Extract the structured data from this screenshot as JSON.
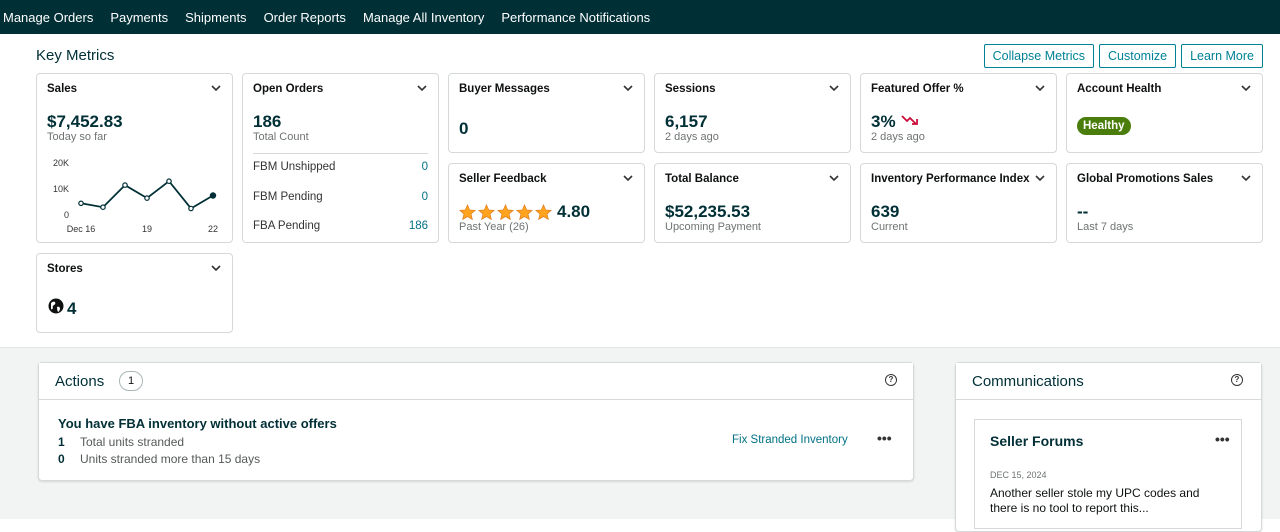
{
  "nav": {
    "items": [
      "Manage Orders",
      "Payments",
      "Shipments",
      "Order Reports",
      "Manage All Inventory",
      "Performance Notifications"
    ]
  },
  "key_metrics": {
    "title": "Key Metrics",
    "buttons": {
      "collapse": "Collapse Metrics",
      "customize": "Customize",
      "learn_more": "Learn More"
    }
  },
  "cards": {
    "sales": {
      "title": "Sales",
      "value": "$7,452.83",
      "sub": "Today so far"
    },
    "open_orders": {
      "title": "Open Orders",
      "value": "186",
      "sub": "Total Count",
      "rows": [
        {
          "label": "FBM Unshipped",
          "value": "0"
        },
        {
          "label": "FBM Pending",
          "value": "0"
        },
        {
          "label": "FBA Pending",
          "value": "186"
        }
      ]
    },
    "buyer_messages": {
      "title": "Buyer Messages",
      "value": "0"
    },
    "sessions": {
      "title": "Sessions",
      "value": "6,157",
      "sub": "2 days ago"
    },
    "featured_offer": {
      "title": "Featured Offer %",
      "value": "3%",
      "sub": "2 days ago",
      "trend_icon": "trend-down-icon"
    },
    "account_health": {
      "title": "Account Health",
      "badge": "Healthy",
      "badge_color": "#4a7d0b"
    },
    "seller_feedback": {
      "title": "Seller Feedback",
      "rating": "4.80",
      "stars": 5,
      "sub": "Past Year (26)"
    },
    "total_balance": {
      "title": "Total Balance",
      "value": "$52,235.53",
      "sub": "Upcoming Payment"
    },
    "inventory_performance": {
      "title": "Inventory Performance Index",
      "value": "639",
      "sub": "Current"
    },
    "global_promotions": {
      "title": "Global Promotions Sales",
      "value": "--",
      "sub": "Last 7 days"
    },
    "stores": {
      "title": "Stores",
      "value": "4",
      "icon": "globe-icon"
    }
  },
  "chart_data": {
    "type": "line",
    "x": [
      "Dec 16",
      "Dec 17",
      "Dec 18",
      "Dec 19",
      "Dec 20",
      "Dec 21",
      "Dec 22"
    ],
    "x_tick_labels": [
      "Dec 16",
      "19",
      "22"
    ],
    "y_tick_labels": [
      "20K",
      "10K",
      "0"
    ],
    "series": [
      {
        "values": [
          4500,
          3000,
          11500,
          6500,
          13000,
          2500,
          7500
        ]
      }
    ],
    "ylim": [
      0,
      20000
    ],
    "color": "#002f36"
  },
  "actions": {
    "title": "Actions",
    "count": "1",
    "item_title": "You have FBA inventory without active offers",
    "rows": [
      {
        "n": "1",
        "label": "Total units stranded"
      },
      {
        "n": "0",
        "label": "Units stranded more than 15 days"
      }
    ],
    "link": "Fix Stranded Inventory"
  },
  "communications": {
    "title": "Communications",
    "forum": {
      "title": "Seller Forums",
      "date": "DEC 15, 2024",
      "text": "Another seller stole my UPC codes and there is no tool to report this..."
    }
  }
}
